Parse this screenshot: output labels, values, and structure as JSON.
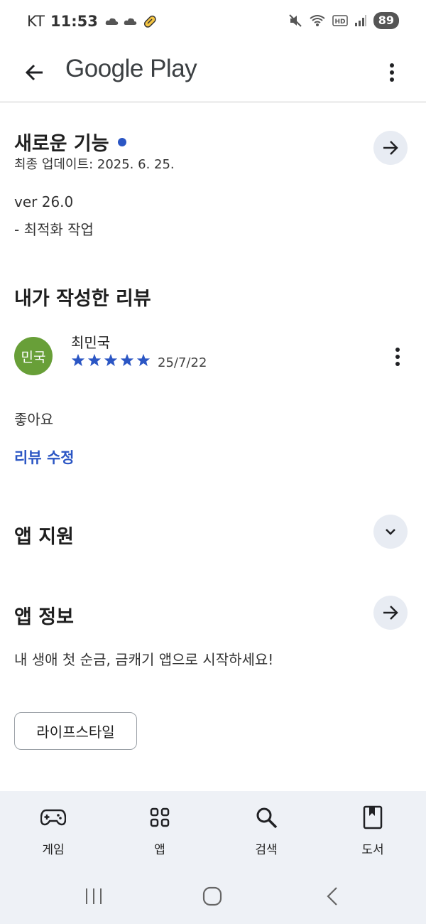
{
  "status_bar": {
    "carrier": "KT",
    "time": "11:53",
    "battery": "89"
  },
  "app_bar": {
    "title": "Google Play"
  },
  "whats_new": {
    "title": "새로운 기능",
    "updated": "최종 업데이트: 2025. 6. 25.",
    "version": "ver 26.0",
    "note": "- 최적화 작업"
  },
  "my_review": {
    "title": "내가 작성한 리뷰",
    "avatar_text": "민국",
    "reviewer": "최민국",
    "rating": 5,
    "date": "25/7/22",
    "body": "좋아요",
    "edit_label": "리뷰 수정"
  },
  "app_support": {
    "title": "앱 지원"
  },
  "app_info": {
    "title": "앱 정보",
    "description": "내 생애 첫 순금, 금캐기 앱으로 시작하세요!",
    "category_chip": "라이프스타일"
  },
  "bottom_nav": {
    "games": "게임",
    "apps": "앱",
    "search": "검색",
    "books": "도서"
  },
  "colors": {
    "accent": "#2b56c4",
    "avatar": "#689f38",
    "nav_bg": "#eef1f6"
  }
}
